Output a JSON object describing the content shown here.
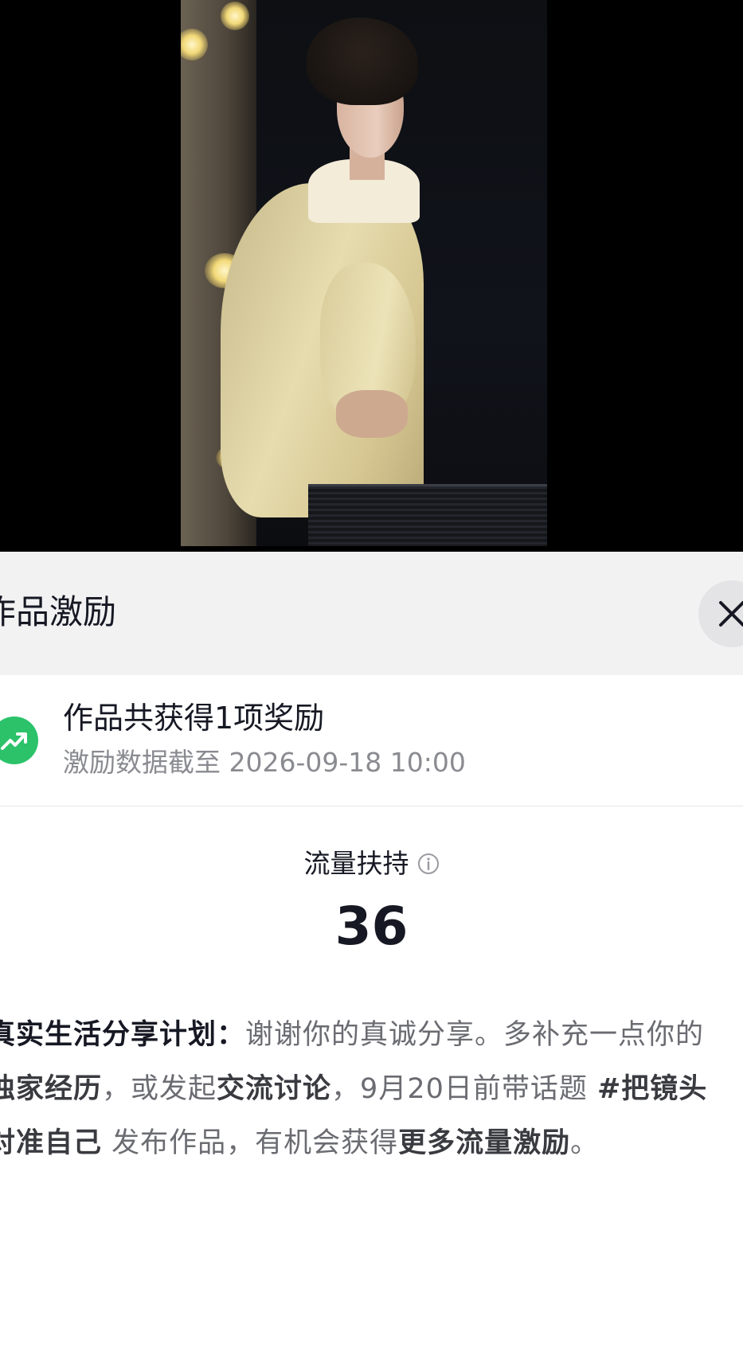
{
  "sheet": {
    "title": "作品激励",
    "close_icon": "close-icon"
  },
  "summary": {
    "icon": "trend-up-icon",
    "title": "作品共获得1项奖励",
    "subtitle": "激励数据截至 2026-09-18 10:00"
  },
  "metric": {
    "label": "流量扶持",
    "info_icon": "info-icon",
    "value": "36"
  },
  "description": {
    "plan_title": "真实生活分享计划：",
    "text_1": "谢谢你的真诚分享。多补充一点你的",
    "highlight_1": "独家经历",
    "text_2": "，或发起",
    "highlight_2": "交流讨论",
    "text_3": "，9月20日前带话题 ",
    "highlight_3": "#把镜头对准自己",
    "text_4": " 发布作品，有机会获得",
    "highlight_4": "更多流量激励",
    "text_5": "。"
  },
  "colors": {
    "accent_green": "#2bc26a",
    "header_bg": "#f2f2f3",
    "text_primary": "#161823",
    "text_secondary": "#8a8b91"
  }
}
